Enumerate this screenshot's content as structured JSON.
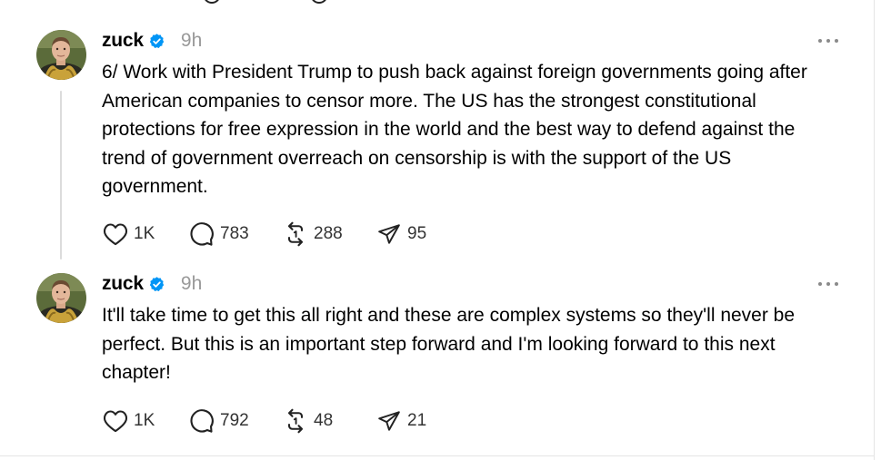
{
  "colors": {
    "verified": "#0095f6",
    "muted": "#999999",
    "divider": "#e5e5e5",
    "text": "#000000"
  },
  "posts": [
    {
      "username": "zuck",
      "time": "9h",
      "verified_icon": "verified-badge-icon",
      "text": "6/ Work with President Trump to push back against foreign governments going after American companies to censor more. The US has the strongest constitutional protections for free expression in the world and the best way to defend against the trend of government overreach on censorship is with the support of the US government.",
      "likes": "1K",
      "replies": "783",
      "reposts": "288",
      "shares": "95"
    },
    {
      "username": "zuck",
      "time": "9h",
      "verified_icon": "verified-badge-icon",
      "text": "It'll take time to get this all right and these are complex systems so they'll never be perfect. But this is an important step forward and I'm looking forward to this next chapter!",
      "likes": "1K",
      "replies": "792",
      "reposts": "48",
      "shares": "21"
    }
  ]
}
